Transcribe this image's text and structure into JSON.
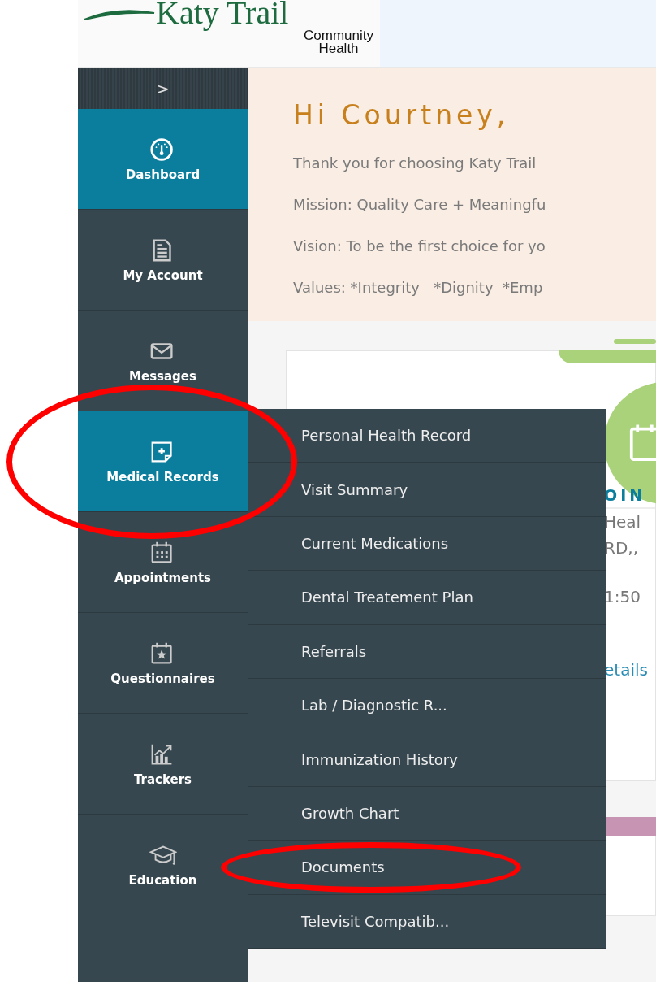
{
  "logo": {
    "name": "Katy Trail",
    "line_2": "Community",
    "line_3": "Health"
  },
  "sidebar": {
    "toggle": ">",
    "items": [
      {
        "label": "Dashboard",
        "selected": true,
        "circled": false
      },
      {
        "label": "My Account",
        "selected": false,
        "circled": false
      },
      {
        "label": "Messages",
        "selected": false,
        "circled": false
      },
      {
        "label": "Medical Records",
        "selected": true,
        "circled": true
      },
      {
        "label": "Appointments",
        "selected": false,
        "circled": false
      },
      {
        "label": "Questionnaires",
        "selected": false,
        "circled": false
      },
      {
        "label": "Trackers",
        "selected": false,
        "circled": false
      },
      {
        "label": "Education",
        "selected": false,
        "circled": false
      }
    ]
  },
  "welcome": {
    "greeting": "Hi Courtney,",
    "lines": [
      "Thank you for choosing Katy Trail",
      "Mission: Quality Care + Meaningfu",
      "Vision: To be the first choice for yo",
      "Values: *Integrity   *Dignity  *Emp"
    ]
  },
  "card": {
    "heading": "OIN",
    "lines": [
      "Heal",
      "RD,,",
      "1:50"
    ],
    "link": "etails"
  },
  "submenu": {
    "items": [
      {
        "label": "Personal Health Record",
        "circled": false
      },
      {
        "label": "Visit Summary",
        "circled": false
      },
      {
        "label": "Current Medications",
        "circled": false
      },
      {
        "label": "Dental Treatement Plan",
        "circled": false
      },
      {
        "label": "Referrals",
        "circled": false
      },
      {
        "label": "Lab / Diagnostic R...",
        "circled": false
      },
      {
        "label": "Immunization History",
        "circled": false
      },
      {
        "label": "Growth Chart",
        "circled": false
      },
      {
        "label": "Documents",
        "circled": true
      },
      {
        "label": "Televisit Compatib...",
        "circled": false
      }
    ]
  }
}
